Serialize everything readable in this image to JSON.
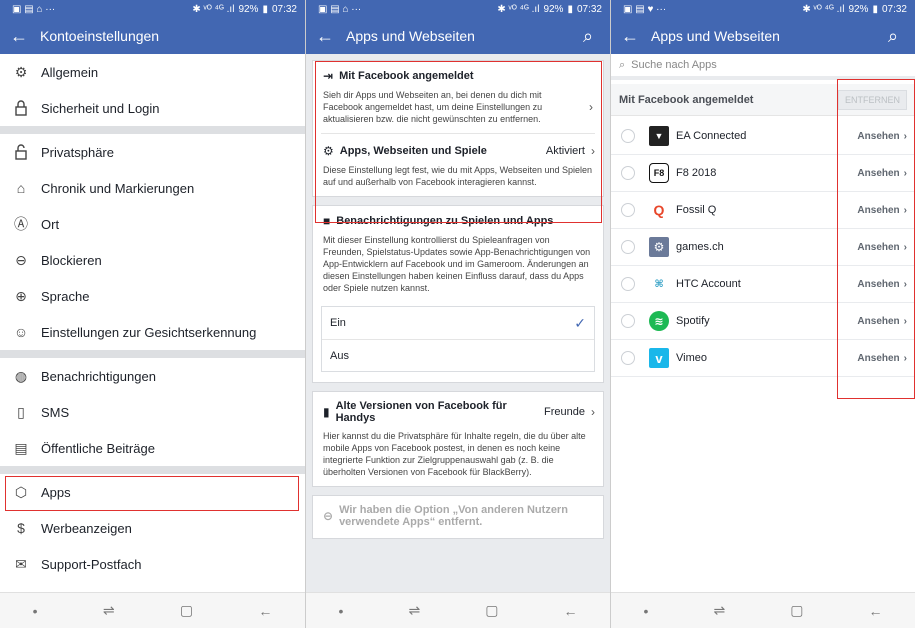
{
  "status": {
    "icons_left": "▣ ▤ ⌂ ···",
    "icons_left_3": "▣ ▤ ♥ ···",
    "signal": "✱ ᵛᴼ ⁴ᴳ .ıl",
    "battery": "92%",
    "time": "07:32"
  },
  "panel1": {
    "title": "Kontoeinstellungen",
    "items": [
      {
        "label": "Allgemein",
        "icon": "gear-icon"
      },
      {
        "label": "Sicherheit und Login",
        "icon": "lock-icon"
      },
      {
        "label": "Privatsphäre",
        "icon": "lock-open-icon"
      },
      {
        "label": "Chronik und Markierungen",
        "icon": "tag-icon"
      },
      {
        "label": "Ort",
        "icon": "location-icon"
      },
      {
        "label": "Blockieren",
        "icon": "block-icon"
      },
      {
        "label": "Sprache",
        "icon": "globe-icon"
      },
      {
        "label": "Einstellungen zur Gesichtserkennung",
        "icon": "face-icon"
      },
      {
        "label": "Benachrichtigungen",
        "icon": "globe-icon"
      },
      {
        "label": "SMS",
        "icon": "phone-icon"
      },
      {
        "label": "Öffentliche Beiträge",
        "icon": "calendar-icon"
      },
      {
        "label": "Apps",
        "icon": "cube-icon"
      },
      {
        "label": "Werbeanzeigen",
        "icon": "ad-icon"
      },
      {
        "label": "Support-Postfach",
        "icon": "mail-icon"
      }
    ]
  },
  "panel2": {
    "title": "Apps und Webseiten",
    "logged_in": {
      "title": "Mit Facebook angemeldet",
      "text": "Sieh dir Apps und Webseiten an, bei denen du dich mit Facebook angemeldet hast, um deine Einstellungen zu aktualisieren bzw. die nicht gewünschten zu entfernen."
    },
    "platform": {
      "title": "Apps, Webseiten und Spiele",
      "value": "Aktiviert",
      "text": "Diese Einstellung legt fest, wie du mit Apps, Webseiten und Spielen auf und außerhalb von Facebook interagieren kannst."
    },
    "game_notifications": {
      "title": "Benachrichtigungen zu Spielen und Apps",
      "text": "Mit dieser Einstellung kontrollierst du Spieleanfragen von Freunden, Spielstatus-Updates sowie App-Benachrichtigungen von App-Entwicklern auf Facebook und im Gameroom. Änderungen an diesen Einstellungen haben keinen Einfluss darauf, dass du Apps oder Spiele nutzen kannst.",
      "option_on": "Ein",
      "option_off": "Aus",
      "check": "✓"
    },
    "old_versions": {
      "title": "Alte Versionen von Facebook für Handys",
      "value": "Freunde",
      "text": "Hier kannst du die Privatsphäre für Inhalte regeln, die du über alte mobile Apps von Facebook postest, in denen es noch keine integrierte Funktion zur Zielgruppenauswahl gab (z. B. die überholten Versionen von Facebook für BlackBerry)."
    },
    "removed": {
      "title": "Wir haben die Option „Von anderen Nutzern verwendete Apps“ entfernt."
    }
  },
  "panel3": {
    "title": "Apps und Webseiten",
    "search_placeholder": "Suche nach Apps",
    "section": "Mit Facebook angemeldet",
    "remove_label": "ENTFERNEN",
    "view_label": "Ansehen",
    "apps": [
      {
        "name": "EA Connected",
        "logo": "ea-logo-icon",
        "logo_color": "#222222"
      },
      {
        "name": "F8 2018",
        "logo": "f8-logo-icon",
        "logo_color": "#111111"
      },
      {
        "name": "Fossil Q",
        "logo": "fossil-logo-icon",
        "logo_color": "#e8462a"
      },
      {
        "name": "games.ch",
        "logo": "games-logo-icon",
        "logo_color": "#6b7a99"
      },
      {
        "name": "HTC Account",
        "logo": "htc-logo-icon",
        "logo_color": "#3aa4c8"
      },
      {
        "name": "Spotify",
        "logo": "spotify-logo-icon",
        "logo_color": "#1db954"
      },
      {
        "name": "Vimeo",
        "logo": "vimeo-logo-icon",
        "logo_color": "#1ab7ea"
      }
    ]
  },
  "colors": {
    "fb_blue": "#4267b2",
    "highlight": "#e0312f"
  }
}
